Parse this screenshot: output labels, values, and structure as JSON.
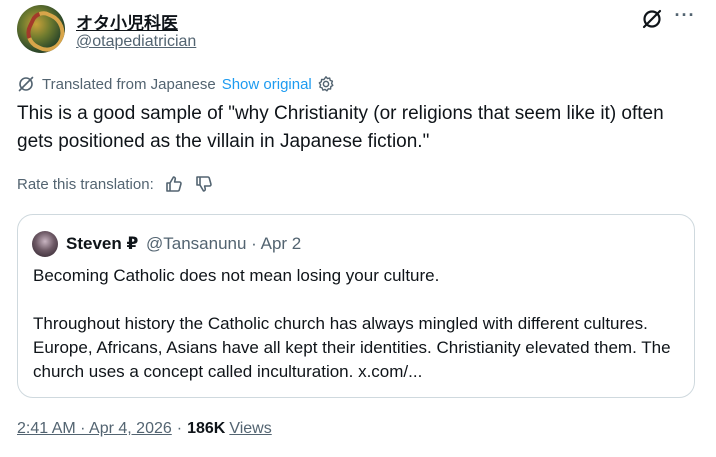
{
  "author": {
    "display_name": "オタ小児科医",
    "handle": "@otapediatrician"
  },
  "translation": {
    "label": "Translated from Japanese",
    "show_original": "Show original"
  },
  "tweet": {
    "text": "This is a good sample of \"why Christianity (or religions that seem like it) often gets positioned as the villain in Japanese fiction.\""
  },
  "rate": {
    "label": "Rate this translation:"
  },
  "quoted": {
    "name": "Steven ₽",
    "meta": "@Tansanunu · Apr 2",
    "para1": "Becoming Catholic does not mean losing your culture.",
    "para2": "Throughout history the Catholic church has always mingled with different cultures. Europe, Africans, Asians have all kept their identities. Christianity elevated them. The church uses a concept called inculturation. x.com/..."
  },
  "footer": {
    "timestamp": "2:41 AM · Apr 4, 2026",
    "separator": "·",
    "views_count": "186K",
    "views_label": "Views"
  },
  "icons": {
    "grok": "grok-icon",
    "more": "more-icon",
    "translate": "translate-icon",
    "gear": "gear-icon",
    "thumbs_up": "thumbs-up-icon",
    "thumbs_down": "thumbs-down-icon"
  },
  "colors": {
    "link_blue": "#1d9bf0",
    "secondary_text": "#536471",
    "primary_text": "#0f1419",
    "border": "#cfd9de"
  }
}
